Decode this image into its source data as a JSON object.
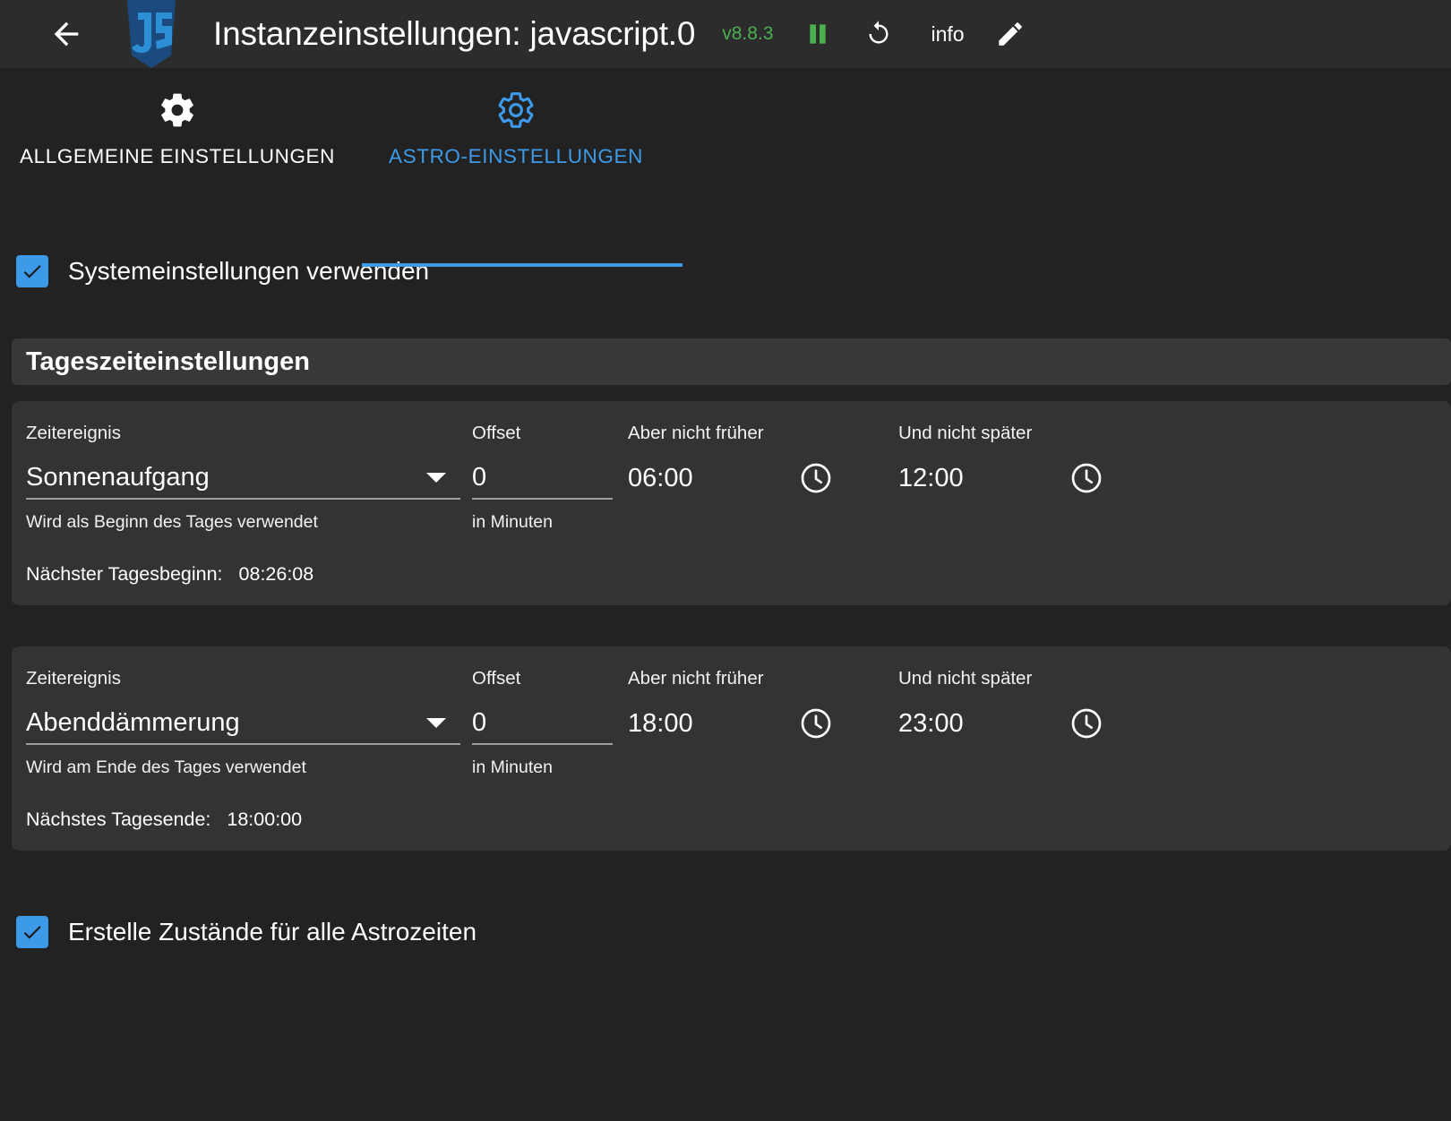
{
  "header": {
    "back_icon": "arrow-left-icon",
    "logo": "javascript-logo",
    "title": "Instanzeinstellungen: javascript.0",
    "version": "v8.8.3",
    "version_color": "#4caf50",
    "pause_icon": "pause-icon",
    "pause_color": "#4caf50",
    "reload_icon": "refresh-icon",
    "info_label": "info",
    "edit_icon": "pencil-icon",
    "bg_color": "#2c2c2c"
  },
  "tabs": {
    "accent_color": "#3d9ae8",
    "items": [
      {
        "label": "ALLGEMEINE EINSTELLUNGEN",
        "icon": "gear-filled-icon",
        "active": false
      },
      {
        "label": "ASTRO-EINSTELLUNGEN",
        "icon": "gear-outline-icon",
        "active": true
      }
    ]
  },
  "main": {
    "use_system_settings": {
      "label": "Systemeinstellungen verwenden",
      "checked": true
    },
    "section_title": "Tageszeiteinstellungen",
    "cards": [
      {
        "event_label": "Zeitereignis",
        "event_value": "Sonnenaufgang",
        "event_hint": "Wird als Beginn des Tages verwendet",
        "offset_label": "Offset",
        "offset_value": "0",
        "offset_hint": "in Minuten",
        "not_earlier_label": "Aber nicht früher",
        "not_earlier_value": "06:00",
        "not_later_label": "Und nicht später",
        "not_later_value": "12:00",
        "next_label": "Nächster Tagesbeginn:",
        "next_value": "08:26:08"
      },
      {
        "event_label": "Zeitereignis",
        "event_value": "Abenddämmerung",
        "event_hint": "Wird am Ende des Tages verwendet",
        "offset_label": "Offset",
        "offset_value": "0",
        "offset_hint": "in Minuten",
        "not_earlier_label": "Aber nicht früher",
        "not_earlier_value": "18:00",
        "not_later_label": "Und nicht später",
        "not_later_value": "23:00",
        "next_label": "Nächstes Tagesende:",
        "next_value": "18:00:00"
      }
    ],
    "create_states": {
      "label": "Erstelle Zustände für alle Astrozeiten",
      "checked": true
    }
  },
  "colors": {
    "page_bg": "#222222",
    "card_bg": "#333333",
    "section_bg": "#383838",
    "accent": "#3d9ae8",
    "green": "#4caf50"
  }
}
